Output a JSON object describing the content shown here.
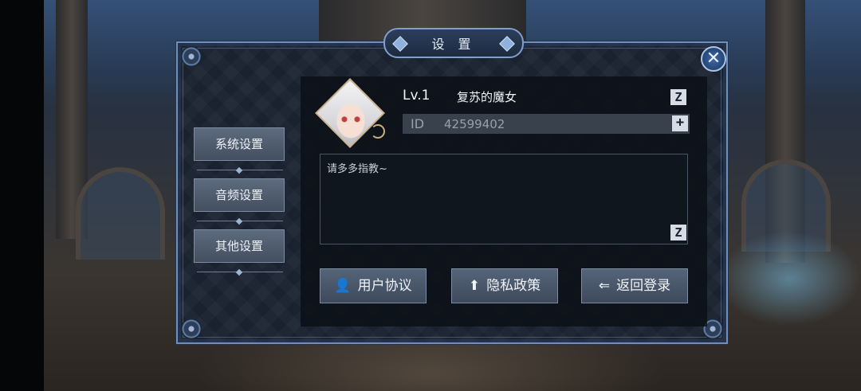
{
  "dialog": {
    "title": "设 置",
    "close_icon": "close-icon"
  },
  "menu": {
    "items": [
      {
        "label": "系统设置"
      },
      {
        "label": "音频设置"
      },
      {
        "label": "其他设置"
      }
    ]
  },
  "profile": {
    "level": "Lv.1",
    "name": "复苏的魔女",
    "id_label": "ID",
    "id_value": "42599402",
    "signature": "请多多指教~",
    "edit_glyph": "Z",
    "copy_glyph": "+"
  },
  "actions": [
    {
      "label": "用户协议",
      "icon": "user-icon",
      "glyph": "👤"
    },
    {
      "label": "隐私政策",
      "icon": "upload-icon",
      "glyph": "⬆"
    },
    {
      "label": "返回登录",
      "icon": "logout-icon",
      "glyph": "⇐"
    }
  ],
  "colors": {
    "frame": "#6e8fb9",
    "button": "#4f5d70",
    "text": "#f0f3f7"
  }
}
